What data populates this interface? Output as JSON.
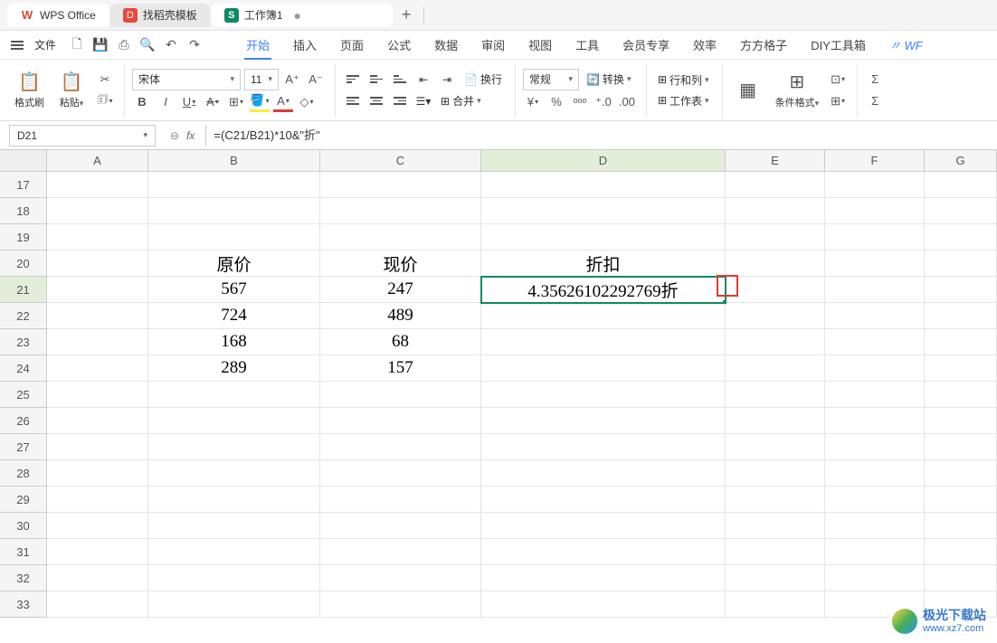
{
  "app": {
    "name": "WPS Office",
    "tabs": {
      "template": "找稻壳模板",
      "workbook": "工作簿1"
    }
  },
  "quickbar": {
    "file": "文件"
  },
  "menu": {
    "start": "开始",
    "insert": "插入",
    "page": "页面",
    "formula": "公式",
    "data": "数据",
    "review": "审阅",
    "view": "视图",
    "tools": "工具",
    "member": "会员专享",
    "efficiency": "效率",
    "ffgz": "方方格子",
    "diy": "DIY工具箱",
    "wp": "WF"
  },
  "ribbon": {
    "format_paint": "格式刷",
    "paste": "粘贴",
    "font_name": "宋体",
    "font_size": "11",
    "wrap": "换行",
    "merge": "合并",
    "general": "常规",
    "convert": "转换",
    "rowcol": "行和列",
    "worksheet": "工作表",
    "condfmt": "条件格式"
  },
  "formula_bar": {
    "name_box": "D21",
    "formula": "=(C21/B21)*10&\"折\""
  },
  "columns": [
    "A",
    "B",
    "C",
    "D",
    "E",
    "F",
    "G"
  ],
  "row_start": 17,
  "row_end": 33,
  "data_rows": {
    "20": {
      "B": "原价",
      "C": "现价",
      "D": "折扣"
    },
    "21": {
      "B": "567",
      "C": "247",
      "D": "4.35626102292769折"
    },
    "22": {
      "B": "724",
      "C": "489"
    },
    "23": {
      "B": "168",
      "C": "68"
    },
    "24": {
      "B": "289",
      "C": "157"
    }
  },
  "selection": {
    "row": 21,
    "col": "D"
  },
  "watermark": {
    "main": "极光下载站",
    "url": "www.xz7.com"
  }
}
